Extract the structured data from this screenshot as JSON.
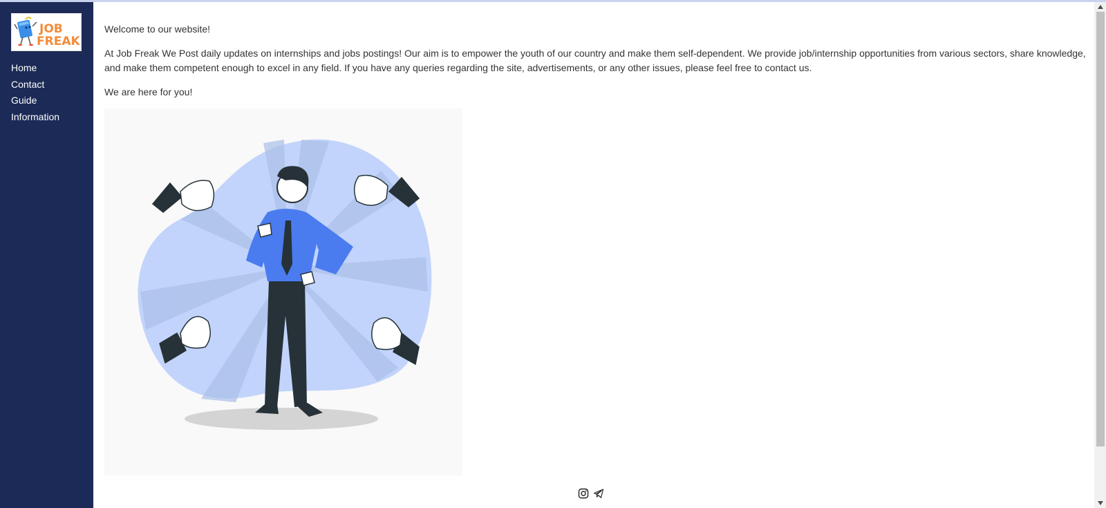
{
  "sidebar": {
    "logo": {
      "line1": "JOB",
      "line2": "FREAK"
    },
    "nav": [
      {
        "label": "Home"
      },
      {
        "label": "Contact"
      },
      {
        "label": "Guide"
      },
      {
        "label": "Information"
      }
    ]
  },
  "main": {
    "welcome": "Welcome to our website!",
    "about": "At Job Freak We Post daily updates on internships and jobs postings! Our aim is to empower the youth of our country and make them self-dependent. We provide job/internship opportunities from various sectors, share knowledge, and make them competent enough to excel in any field. If you have any queries regarding the site, advertisements, or any other issues, please feel free to contact us.",
    "tagline": "We are here for you!"
  },
  "footer": {
    "icons": [
      "instagram-icon",
      "telegram-icon"
    ]
  },
  "colors": {
    "sidebar_bg": "#1b2a56",
    "logo_orange": "#f28c3a",
    "hero_blue": "#4a7cf0",
    "hero_blob": "#c2d4fb"
  }
}
